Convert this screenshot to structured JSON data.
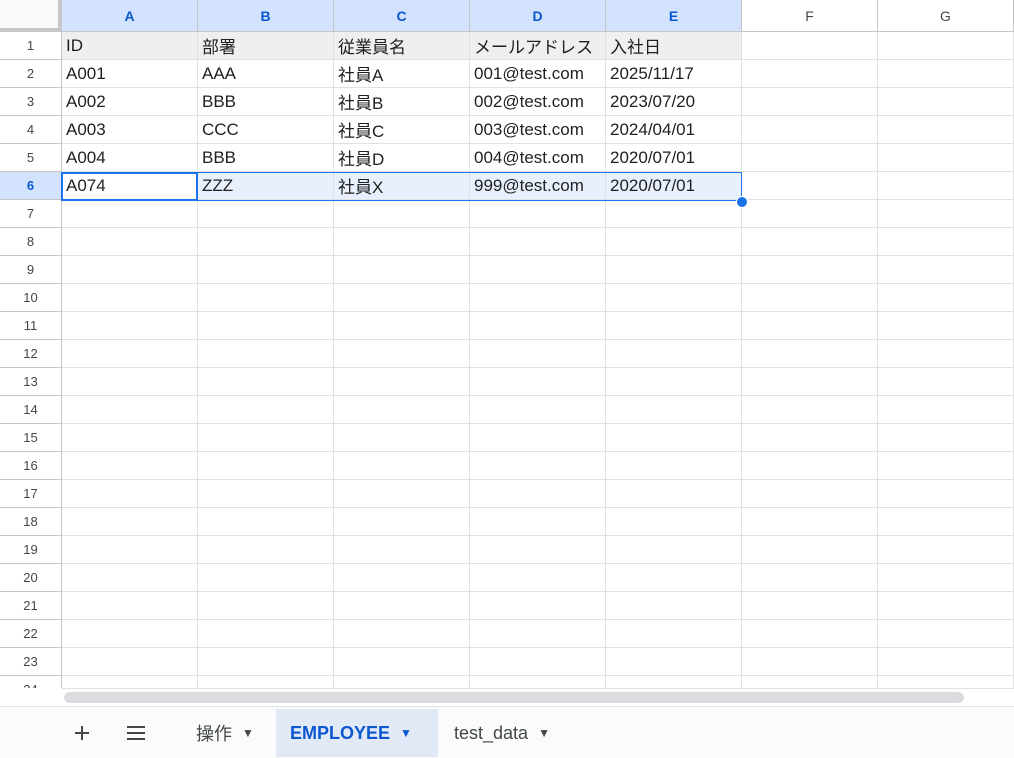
{
  "columns": [
    "A",
    "B",
    "C",
    "D",
    "E",
    "F",
    "G"
  ],
  "rows": [
    "1",
    "2",
    "3",
    "4",
    "5",
    "6",
    "7",
    "8",
    "9",
    "10",
    "11",
    "12",
    "13",
    "14",
    "15",
    "16",
    "17",
    "18",
    "19",
    "20",
    "21",
    "22",
    "23",
    "24"
  ],
  "cells": [
    [
      "ID",
      "部署",
      "従業員名",
      "メールアドレス",
      "入社日"
    ],
    [
      "A001",
      "AAA",
      "社員A",
      "001@test.com",
      "2025/11/17"
    ],
    [
      "A002",
      "BBB",
      "社員B",
      "002@test.com",
      "2023/07/20"
    ],
    [
      "A003",
      "CCC",
      "社員C",
      "003@test.com",
      "2024/04/01"
    ],
    [
      "A004",
      "BBB",
      "社員D",
      "004@test.com",
      "2020/07/01"
    ],
    [
      "A074",
      "ZZZ",
      "社員X",
      "999@test.com",
      "2020/07/01"
    ]
  ],
  "selected_row": "6",
  "selected_columns": [
    "A",
    "B",
    "C",
    "D",
    "E"
  ],
  "sheetbar": {
    "add_icon": "plus-icon",
    "all_sheets_icon": "menu-icon",
    "tabs": [
      {
        "label": "操作",
        "active": false
      },
      {
        "label": "EMPLOYEE",
        "active": true
      },
      {
        "label": "test_data",
        "active": false
      }
    ],
    "caret_icon": "▼"
  },
  "colors": {
    "selection": "#1a73e8",
    "selected_header_bg": "#d3e3fd",
    "active_tab_text": "#0b57d0"
  }
}
